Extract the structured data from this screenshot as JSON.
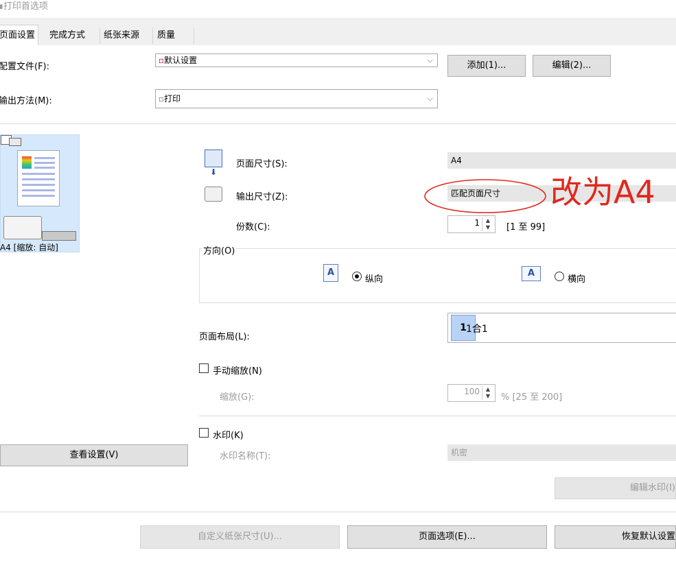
{
  "window": {
    "title": "打印首选项"
  },
  "tabs": [
    {
      "label": "页面设置",
      "active": true
    },
    {
      "label": "完成方式",
      "active": false
    },
    {
      "label": "纸张来源",
      "active": false
    },
    {
      "label": "质量",
      "active": false
    }
  ],
  "profile": {
    "label": "配置文件(F):",
    "value": "默认设置",
    "add_label": "添加(1)...",
    "edit_label": "编辑(2)..."
  },
  "output_method": {
    "label": "输出方法(M):",
    "value": "打印"
  },
  "preview": {
    "caption": "A4 [缩放: 自动]",
    "view_settings_label": "查看设置(V)"
  },
  "page_size": {
    "label": "页面尺寸(S):",
    "value": "A4"
  },
  "output_size": {
    "label": "输出尺寸(Z):",
    "value": "匹配页面尺寸"
  },
  "annotation": {
    "text": "改为A4",
    "color": "#e0281e"
  },
  "copies": {
    "label": "份数(C):",
    "value": "1",
    "range": "[1 至 99]"
  },
  "orientation": {
    "group_label": "方向(O)",
    "portrait_label": "纵向",
    "landscape_label": "横向",
    "page_glyph": "A",
    "selected": "portrait"
  },
  "layout": {
    "label": "页面布局(L):",
    "value": "1合1",
    "thumb_text": "1"
  },
  "manual_scale": {
    "label": "手动缩放(N)",
    "checked": false,
    "scale_label": "缩放(G):",
    "scale_value": "100",
    "scale_range": "% [25 至 200]"
  },
  "watermark": {
    "label": "水印(K)",
    "checked": false,
    "name_label": "水印名称(T):",
    "name_value": "机密",
    "edit_label": "编辑水印(I)"
  },
  "bottom_buttons": {
    "custom_paper": "自定义纸张尺寸(U)...",
    "page_options": "页面选项(E)...",
    "restore_defaults": "恢复默认设置"
  }
}
